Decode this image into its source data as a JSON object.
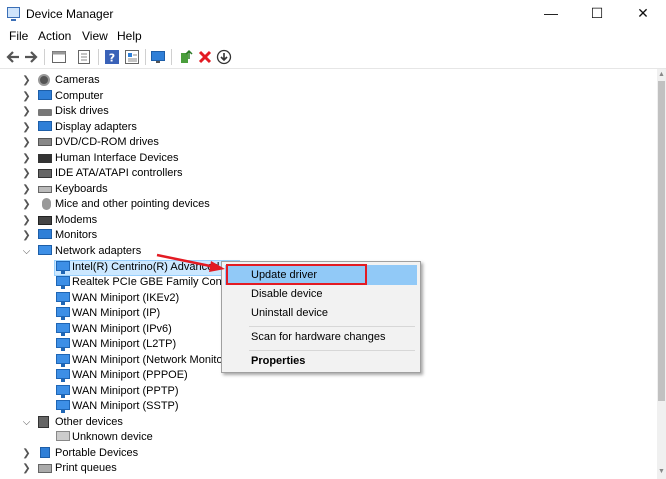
{
  "window": {
    "title": "Device Manager",
    "minimize": "—",
    "maximize": "☐",
    "close": "✕"
  },
  "menu": [
    "File",
    "Action",
    "View",
    "Help"
  ],
  "toolbar": [
    "back-icon",
    "forward-icon",
    "properties-pane-icon",
    "device-list-icon",
    "help-icon",
    "show-hidden-icon",
    "monitor-scan-icon",
    "update-driver-icon",
    "uninstall-icon",
    "download-icon"
  ],
  "colors": {
    "selection": "#cce8ff",
    "context_highlight": "#91c9f7",
    "annotation": "#e31b23"
  },
  "tree": {
    "categories": [
      {
        "label": "Cameras",
        "icon": "camera-icon",
        "expanded": false
      },
      {
        "label": "Computer",
        "icon": "computer-icon",
        "expanded": false
      },
      {
        "label": "Disk drives",
        "icon": "disk-icon",
        "expanded": false
      },
      {
        "label": "Display adapters",
        "icon": "display-adapter-icon",
        "expanded": false
      },
      {
        "label": "DVD/CD-ROM drives",
        "icon": "dvd-icon",
        "expanded": false
      },
      {
        "label": "Human Interface Devices",
        "icon": "hid-icon",
        "expanded": false
      },
      {
        "label": "IDE ATA/ATAPI controllers",
        "icon": "ide-icon",
        "expanded": false
      },
      {
        "label": "Keyboards",
        "icon": "keyboard-icon",
        "expanded": false
      },
      {
        "label": "Mice and other pointing devices",
        "icon": "mouse-icon",
        "expanded": false
      },
      {
        "label": "Modems",
        "icon": "modem-icon",
        "expanded": false
      },
      {
        "label": "Monitors",
        "icon": "monitor-icon",
        "expanded": false
      },
      {
        "label": "Network adapters",
        "icon": "network-icon",
        "expanded": true
      },
      {
        "label": "Other devices",
        "icon": "other-devices-icon",
        "expanded": true
      },
      {
        "label": "Portable Devices",
        "icon": "portable-icon",
        "expanded": false
      },
      {
        "label": "Print queues",
        "icon": "print-icon",
        "expanded": false
      }
    ],
    "network_children": [
      "Intel(R) Centrino(R) Advanced-N",
      "Realtek PCIe GBE Family Controll",
      "WAN Miniport (IKEv2)",
      "WAN Miniport (IP)",
      "WAN Miniport (IPv6)",
      "WAN Miniport (L2TP)",
      "WAN Miniport (Network Monito",
      "WAN Miniport (PPPOE)",
      "WAN Miniport (PPTP)",
      "WAN Miniport (SSTP)"
    ],
    "other_children": [
      "Unknown device"
    ]
  },
  "context_menu": {
    "update": "Update driver",
    "disable": "Disable device",
    "uninstall": "Uninstall device",
    "scan": "Scan for hardware changes",
    "properties": "Properties"
  }
}
